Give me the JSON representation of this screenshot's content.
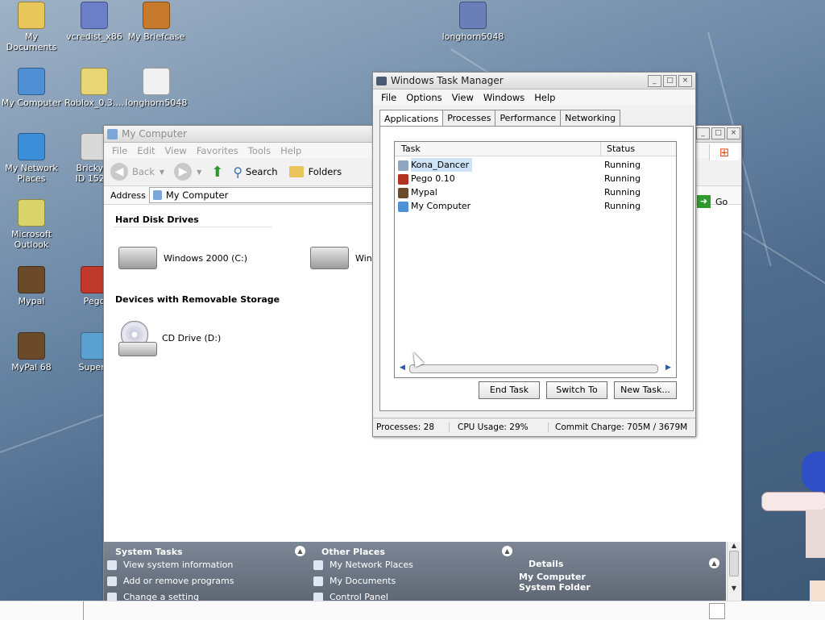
{
  "desktop": {
    "icons": [
      {
        "label": "My\nDocuments",
        "icon": "folder-documents-icon",
        "color": "#e7c65a"
      },
      {
        "label": "vcredist_x86",
        "icon": "installer-icon",
        "color": "#6b7fc9"
      },
      {
        "label": "My Briefcase",
        "icon": "briefcase-icon",
        "color": "#c87a2c"
      },
      {
        "label": "longhorn5048",
        "icon": "program-icon",
        "color": "#6a7fb8"
      },
      {
        "label": "My Computer",
        "icon": "computer-icon",
        "color": "#4f8fd6"
      },
      {
        "label": "Roblox_0.3....",
        "icon": "zip-folder-icon",
        "color": "#e8d676"
      },
      {
        "label": "longhorn5048",
        "icon": "text-file-icon",
        "color": "#f0f0f0"
      },
      {
        "label": "My Network\nPlaces",
        "icon": "network-icon",
        "color": "#3b8fd9"
      },
      {
        "label": "Brickyar\nID 1527,",
        "icon": "app-icon",
        "color": "#d9d9d9"
      },
      {
        "label": "Microsoft\nOutlook",
        "icon": "outlook-icon",
        "color": "#d8d46a"
      },
      {
        "label": "Mypal",
        "icon": "mypal-icon",
        "color": "#6b4a2a"
      },
      {
        "label": "Pego",
        "icon": "pego-icon",
        "color": "#c0392b"
      },
      {
        "label": "MyPal 68",
        "icon": "mypal-icon",
        "color": "#6b4a2a"
      },
      {
        "label": "Supern",
        "icon": "app-icon",
        "color": "#5aa0d0"
      }
    ]
  },
  "my_computer": {
    "title": "My Computer",
    "menu": [
      "File",
      "Edit",
      "View",
      "Favorites",
      "Tools",
      "Help"
    ],
    "toolbar": {
      "back": "Back",
      "search": "Search",
      "folders": "Folders"
    },
    "address_label": "Address",
    "address_value": "My Computer",
    "go": "Go",
    "section_hdd": "Hard Disk Drives",
    "drive_c": "Windows 2000 (C:)",
    "drive_2": "Winc",
    "section_removable": "Devices with Removable Storage",
    "drive_d": "CD Drive (D:)",
    "system_tasks": {
      "title": "System Tasks",
      "items": [
        "View system information",
        "Add or remove programs",
        "Change a setting"
      ]
    },
    "other_places": {
      "title": "Other Places",
      "items": [
        "My Network Places",
        "My Documents",
        "Control Panel"
      ]
    },
    "details": {
      "title": "Details",
      "name": "My Computer",
      "type": "System Folder"
    }
  },
  "task_manager": {
    "title": "Windows Task Manager",
    "menu": [
      "File",
      "Options",
      "View",
      "Windows",
      "Help"
    ],
    "tabs": [
      "Applications",
      "Processes",
      "Performance",
      "Networking"
    ],
    "columns": [
      "Task",
      "Status"
    ],
    "tasks": [
      {
        "name": "Kona_Dancer",
        "status": "Running",
        "icon": "kona-icon",
        "color": "#8fa6c0"
      },
      {
        "name": "Pego 0.10",
        "status": "Running",
        "icon": "pego-icon",
        "color": "#b0321f"
      },
      {
        "name": "Mypal",
        "status": "Running",
        "icon": "mypal-icon",
        "color": "#6b4a2a"
      },
      {
        "name": "My Computer",
        "status": "Running",
        "icon": "computer-icon",
        "color": "#4f8fd6"
      }
    ],
    "buttons": {
      "end_task": "End Task",
      "switch_to": "Switch To",
      "new_task": "New Task..."
    },
    "status": {
      "processes": "Processes: 28",
      "cpu": "CPU Usage: 29%",
      "commit": "Commit Charge: 705M / 3679M"
    }
  }
}
